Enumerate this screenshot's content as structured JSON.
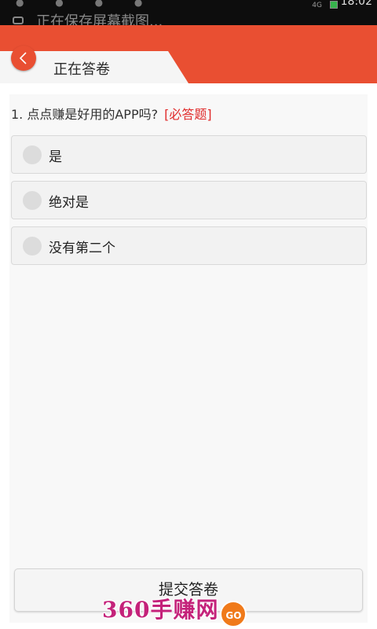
{
  "status_bar": {
    "time": "18:02",
    "network": "4G"
  },
  "notification": {
    "text": "正在保存屏幕截图..."
  },
  "header": {
    "title": "正在答卷"
  },
  "question": {
    "text": "1. 点点赚是好用的APP吗?",
    "required_label": "[必答题]"
  },
  "options": [
    {
      "label": "是",
      "selected": false
    },
    {
      "label": "绝对是",
      "selected": false
    },
    {
      "label": "没有第二个",
      "selected": false
    }
  ],
  "submit": {
    "label": "提交答卷"
  },
  "watermark": {
    "text": "360手赚网",
    "badge": "GO"
  },
  "colors": {
    "accent": "#e94f32",
    "required": "#e02b2b",
    "card_bg": "#f8f8f8",
    "option_bg": "#f2f2f2"
  }
}
